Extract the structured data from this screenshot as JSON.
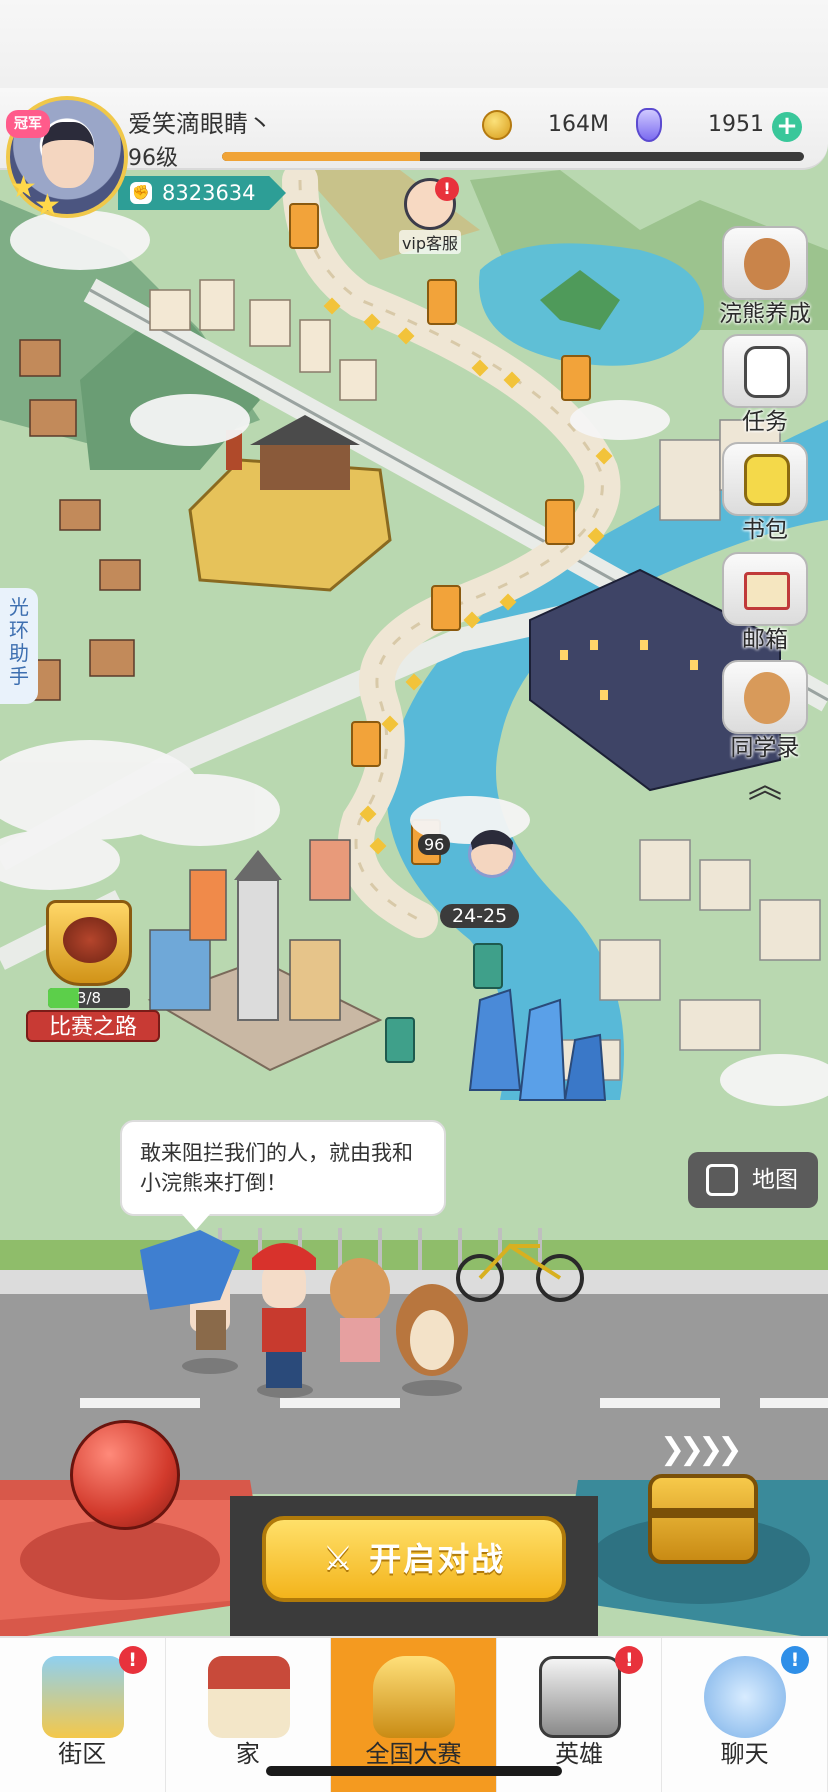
{
  "profile": {
    "nickname": "爱笑滴眼睛丶",
    "level": "96级",
    "level_progress": 0.34,
    "power": "8323634",
    "avatar_tag": "冠军"
  },
  "currency": {
    "coins": "164M",
    "gems": "1951"
  },
  "vip_service": {
    "label": "vip客服",
    "alert": "!"
  },
  "side_menu": [
    {
      "label": "浣熊养成",
      "icon": "raccoon-icon"
    },
    {
      "label": "任务",
      "icon": "clipboard-icon"
    },
    {
      "label": "书包",
      "icon": "backpack-icon"
    },
    {
      "label": "邮箱",
      "icon": "envelope-icon"
    },
    {
      "label": "同学录",
      "icon": "raccoon-classmate-icon"
    }
  ],
  "helper_tab": "光环助手",
  "competition": {
    "progress": "3/8",
    "progress_fraction": 0.375,
    "label": "比赛之路"
  },
  "player_marker": {
    "level": "96",
    "stage": "24-25"
  },
  "dialogue": "敢来阻拦我们的人，就由我和小浣熊来打倒！",
  "map_button": "地图",
  "start_battle": "开启对战",
  "colors": {
    "accent": "#f49a20",
    "start_button": "#f3b41c",
    "badge_red": "#e8323c",
    "badge_blue": "#2f8fe8",
    "power_bar": "#2d9e96"
  },
  "tabs": [
    {
      "label": "街区",
      "icon": "signpost-icon",
      "badge": "!",
      "badge_color": "red",
      "active": false
    },
    {
      "label": "家",
      "icon": "house-icon",
      "badge": "",
      "active": false
    },
    {
      "label": "全国大赛",
      "icon": "trophy-icon",
      "badge": "",
      "active": true
    },
    {
      "label": "英雄",
      "icon": "cards-icon",
      "badge": "!",
      "badge_color": "red",
      "active": false
    },
    {
      "label": "聊天",
      "icon": "chat-bubble-icon",
      "badge": "!",
      "badge_color": "blue",
      "active": false
    }
  ]
}
